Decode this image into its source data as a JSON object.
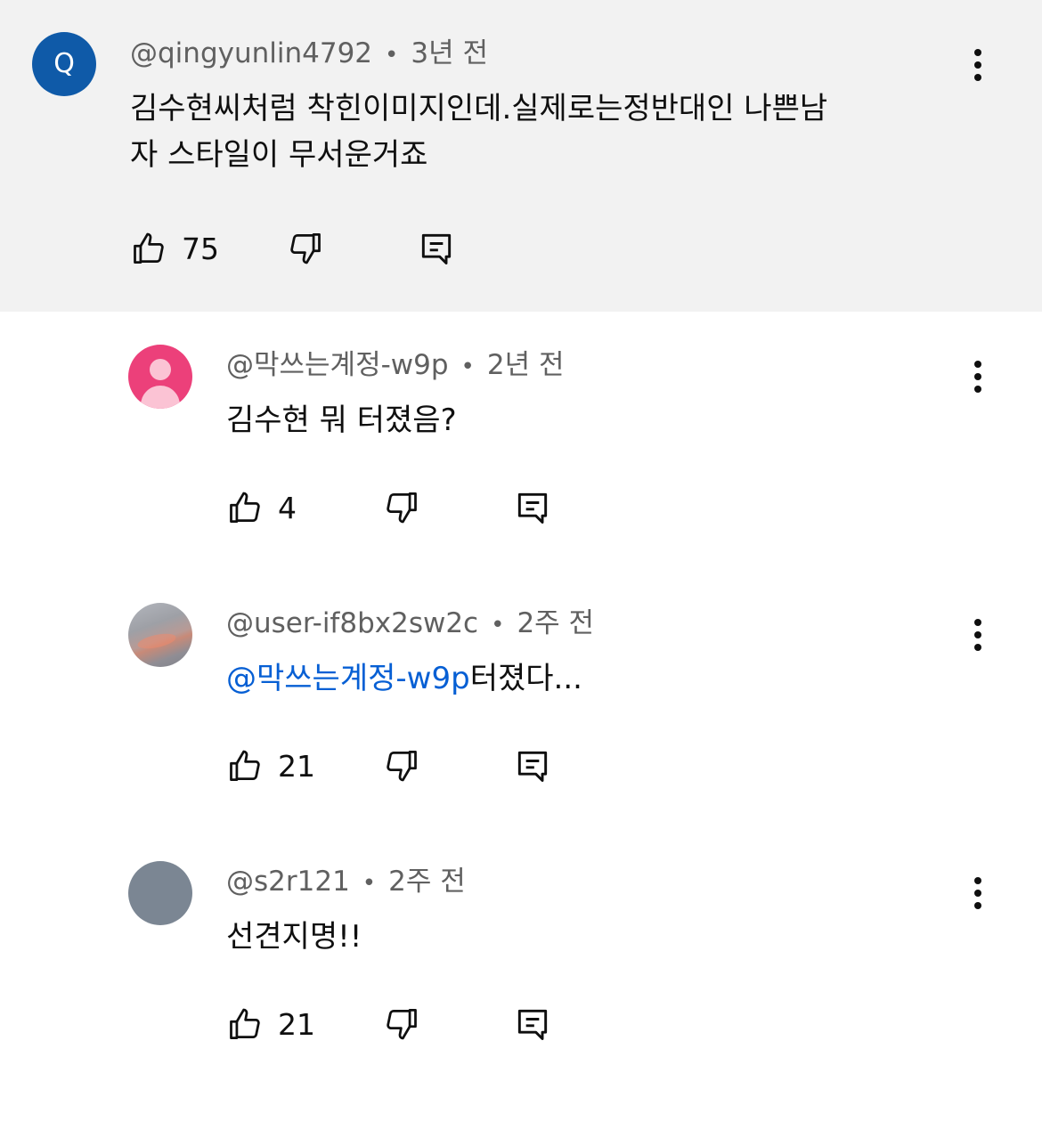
{
  "comments": [
    {
      "author": "@qingyunlin4792",
      "time": "3년 전",
      "avatar_letter": "Q",
      "avatar_color": "#0f5aa8",
      "text_line1": "김수현씨처럼 착힌이미지인데.실제로는정반대인 나쁜남",
      "text_line2": "자 스타일이 무서운거죠",
      "likes": "75"
    },
    {
      "author": "@막쓰는계정-w9p",
      "time": "2년 전",
      "avatar_color": "#ec407a",
      "text": "김수현 뭐 터졌음?",
      "likes": "4"
    },
    {
      "author": "@user-if8bx2sw2c",
      "time": "2주 전",
      "mention": "@막쓰는계정-w9p",
      "text": "터졌다...",
      "likes": "21"
    },
    {
      "author": "@s2r121",
      "time": "2주 전",
      "avatar_color": "#7b8693",
      "text": "선견지명!!",
      "likes": "21"
    }
  ],
  "separator": "•",
  "colors": {
    "top_background": "#f2f2f2",
    "meta_text": "#606060",
    "mention": "#065fd4"
  },
  "icons": {
    "like": "thumbs-up-icon",
    "dislike": "thumbs-down-icon",
    "reply": "reply-comment-icon",
    "menu": "more-vert-icon"
  }
}
